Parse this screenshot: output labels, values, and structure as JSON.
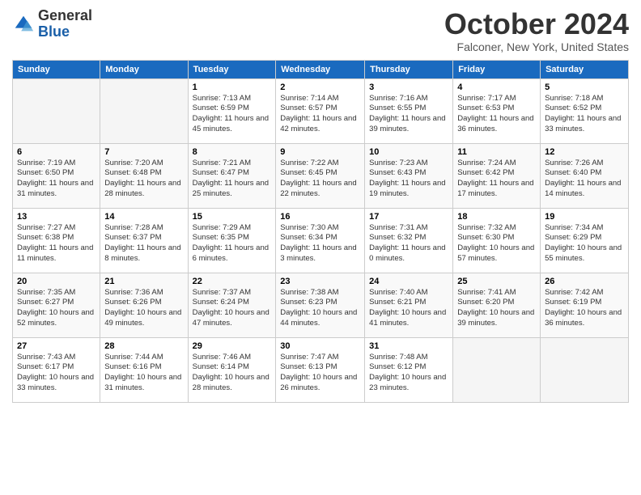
{
  "header": {
    "logo_line1": "General",
    "logo_line2": "Blue",
    "month_title": "October 2024",
    "subtitle": "Falconer, New York, United States"
  },
  "weekdays": [
    "Sunday",
    "Monday",
    "Tuesday",
    "Wednesday",
    "Thursday",
    "Friday",
    "Saturday"
  ],
  "weeks": [
    [
      {
        "day": "",
        "info": ""
      },
      {
        "day": "",
        "info": ""
      },
      {
        "day": "1",
        "info": "Sunrise: 7:13 AM\nSunset: 6:59 PM\nDaylight: 11 hours and 45 minutes."
      },
      {
        "day": "2",
        "info": "Sunrise: 7:14 AM\nSunset: 6:57 PM\nDaylight: 11 hours and 42 minutes."
      },
      {
        "day": "3",
        "info": "Sunrise: 7:16 AM\nSunset: 6:55 PM\nDaylight: 11 hours and 39 minutes."
      },
      {
        "day": "4",
        "info": "Sunrise: 7:17 AM\nSunset: 6:53 PM\nDaylight: 11 hours and 36 minutes."
      },
      {
        "day": "5",
        "info": "Sunrise: 7:18 AM\nSunset: 6:52 PM\nDaylight: 11 hours and 33 minutes."
      }
    ],
    [
      {
        "day": "6",
        "info": "Sunrise: 7:19 AM\nSunset: 6:50 PM\nDaylight: 11 hours and 31 minutes."
      },
      {
        "day": "7",
        "info": "Sunrise: 7:20 AM\nSunset: 6:48 PM\nDaylight: 11 hours and 28 minutes."
      },
      {
        "day": "8",
        "info": "Sunrise: 7:21 AM\nSunset: 6:47 PM\nDaylight: 11 hours and 25 minutes."
      },
      {
        "day": "9",
        "info": "Sunrise: 7:22 AM\nSunset: 6:45 PM\nDaylight: 11 hours and 22 minutes."
      },
      {
        "day": "10",
        "info": "Sunrise: 7:23 AM\nSunset: 6:43 PM\nDaylight: 11 hours and 19 minutes."
      },
      {
        "day": "11",
        "info": "Sunrise: 7:24 AM\nSunset: 6:42 PM\nDaylight: 11 hours and 17 minutes."
      },
      {
        "day": "12",
        "info": "Sunrise: 7:26 AM\nSunset: 6:40 PM\nDaylight: 11 hours and 14 minutes."
      }
    ],
    [
      {
        "day": "13",
        "info": "Sunrise: 7:27 AM\nSunset: 6:38 PM\nDaylight: 11 hours and 11 minutes."
      },
      {
        "day": "14",
        "info": "Sunrise: 7:28 AM\nSunset: 6:37 PM\nDaylight: 11 hours and 8 minutes."
      },
      {
        "day": "15",
        "info": "Sunrise: 7:29 AM\nSunset: 6:35 PM\nDaylight: 11 hours and 6 minutes."
      },
      {
        "day": "16",
        "info": "Sunrise: 7:30 AM\nSunset: 6:34 PM\nDaylight: 11 hours and 3 minutes."
      },
      {
        "day": "17",
        "info": "Sunrise: 7:31 AM\nSunset: 6:32 PM\nDaylight: 11 hours and 0 minutes."
      },
      {
        "day": "18",
        "info": "Sunrise: 7:32 AM\nSunset: 6:30 PM\nDaylight: 10 hours and 57 minutes."
      },
      {
        "day": "19",
        "info": "Sunrise: 7:34 AM\nSunset: 6:29 PM\nDaylight: 10 hours and 55 minutes."
      }
    ],
    [
      {
        "day": "20",
        "info": "Sunrise: 7:35 AM\nSunset: 6:27 PM\nDaylight: 10 hours and 52 minutes."
      },
      {
        "day": "21",
        "info": "Sunrise: 7:36 AM\nSunset: 6:26 PM\nDaylight: 10 hours and 49 minutes."
      },
      {
        "day": "22",
        "info": "Sunrise: 7:37 AM\nSunset: 6:24 PM\nDaylight: 10 hours and 47 minutes."
      },
      {
        "day": "23",
        "info": "Sunrise: 7:38 AM\nSunset: 6:23 PM\nDaylight: 10 hours and 44 minutes."
      },
      {
        "day": "24",
        "info": "Sunrise: 7:40 AM\nSunset: 6:21 PM\nDaylight: 10 hours and 41 minutes."
      },
      {
        "day": "25",
        "info": "Sunrise: 7:41 AM\nSunset: 6:20 PM\nDaylight: 10 hours and 39 minutes."
      },
      {
        "day": "26",
        "info": "Sunrise: 7:42 AM\nSunset: 6:19 PM\nDaylight: 10 hours and 36 minutes."
      }
    ],
    [
      {
        "day": "27",
        "info": "Sunrise: 7:43 AM\nSunset: 6:17 PM\nDaylight: 10 hours and 33 minutes."
      },
      {
        "day": "28",
        "info": "Sunrise: 7:44 AM\nSunset: 6:16 PM\nDaylight: 10 hours and 31 minutes."
      },
      {
        "day": "29",
        "info": "Sunrise: 7:46 AM\nSunset: 6:14 PM\nDaylight: 10 hours and 28 minutes."
      },
      {
        "day": "30",
        "info": "Sunrise: 7:47 AM\nSunset: 6:13 PM\nDaylight: 10 hours and 26 minutes."
      },
      {
        "day": "31",
        "info": "Sunrise: 7:48 AM\nSunset: 6:12 PM\nDaylight: 10 hours and 23 minutes."
      },
      {
        "day": "",
        "info": ""
      },
      {
        "day": "",
        "info": ""
      }
    ]
  ]
}
